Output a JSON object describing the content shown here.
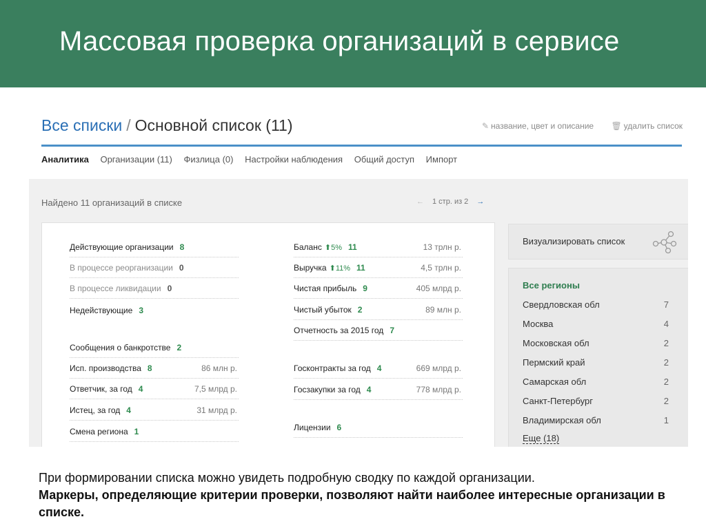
{
  "slide": {
    "title": "Массовая проверка организаций в сервисе",
    "caption_plain": "При формировании списка можно увидеть подробную сводку по каждой организации.",
    "caption_bold": "Маркеры, определяющие критерии проверки, позволяют найти наиболее интересные организации в списке."
  },
  "colors": {
    "banner": "#3a7f5e",
    "accent_blue": "#4a90c8",
    "accent_green": "#2e8a4e"
  },
  "header": {
    "breadcrumb_all": "Все списки",
    "breadcrumb_sep": "/",
    "breadcrumb_current": "Основной список (11)",
    "action_edit": "название, цвет и описание",
    "action_edit_icon": "pencil-icon",
    "action_delete": "удалить список",
    "action_delete_icon": "trash-icon"
  },
  "tabs": [
    {
      "label": "Аналитика",
      "active": true
    },
    {
      "label": "Организации (11)",
      "active": false
    },
    {
      "label": "Физлица (0)",
      "active": false
    },
    {
      "label": "Настройки наблюдения",
      "active": false
    },
    {
      "label": "Общий доступ",
      "active": false
    },
    {
      "label": "Импорт",
      "active": false
    }
  ],
  "summary": {
    "found_text": "Найдено 11 организаций в списке",
    "pager_prev": "←",
    "pager_text": "1 стр. из 2",
    "pager_next": "→"
  },
  "left_col": {
    "status": [
      {
        "label": "Действующие организации",
        "count": "8"
      },
      {
        "label": "В процессе реорганизации",
        "count": "0"
      },
      {
        "label": "В процессе ликвидации",
        "count": "0"
      },
      {
        "label": "Недействующие",
        "count": "3"
      }
    ],
    "legal": [
      {
        "label": "Сообщения о банкротстве",
        "count": "2",
        "value": ""
      },
      {
        "label": "Исп. производства",
        "count": "8",
        "value": "86 млн р."
      },
      {
        "label": "Ответчик, за год",
        "count": "4",
        "value": "7,5 млрд р."
      },
      {
        "label": "Истец, за год",
        "count": "4",
        "value": "31 млрд р."
      },
      {
        "label": "Смена региона",
        "count": "1",
        "value": ""
      }
    ]
  },
  "right_col": {
    "finance": [
      {
        "label": "Баланс",
        "change": "5%",
        "count": "11",
        "value": "13 трлн р."
      },
      {
        "label": "Выручка",
        "change": "11%",
        "count": "11",
        "value": "4,5 трлн р."
      },
      {
        "label": "Чистая прибыль",
        "change": "",
        "count": "9",
        "value": "405 млрд р."
      },
      {
        "label": "Чистый убыток",
        "change": "",
        "count": "2",
        "value": "89 млн р."
      },
      {
        "label": "Отчетность за 2015 год",
        "change": "",
        "count": "7",
        "value": ""
      }
    ],
    "contracts": [
      {
        "label": "Госконтракты за год",
        "count": "4",
        "value": "669 млрд р."
      },
      {
        "label": "Госзакупки за год",
        "count": "4",
        "value": "778 млрд р."
      }
    ],
    "licenses": {
      "label": "Лицензии",
      "count": "6"
    }
  },
  "sidebar": {
    "visualize_label": "Визуализировать список",
    "visualize_icon": "network-graph-icon",
    "regions_head": "Все регионы",
    "regions": [
      {
        "name": "Свердловская обл",
        "count": "7"
      },
      {
        "name": "Москва",
        "count": "4"
      },
      {
        "name": "Московская обл",
        "count": "2"
      },
      {
        "name": "Пермский край",
        "count": "2"
      },
      {
        "name": "Самарская обл",
        "count": "2"
      },
      {
        "name": "Санкт-Петербург",
        "count": "2"
      },
      {
        "name": "Владимирская обл",
        "count": "1"
      }
    ],
    "more": "Еще (18)"
  }
}
